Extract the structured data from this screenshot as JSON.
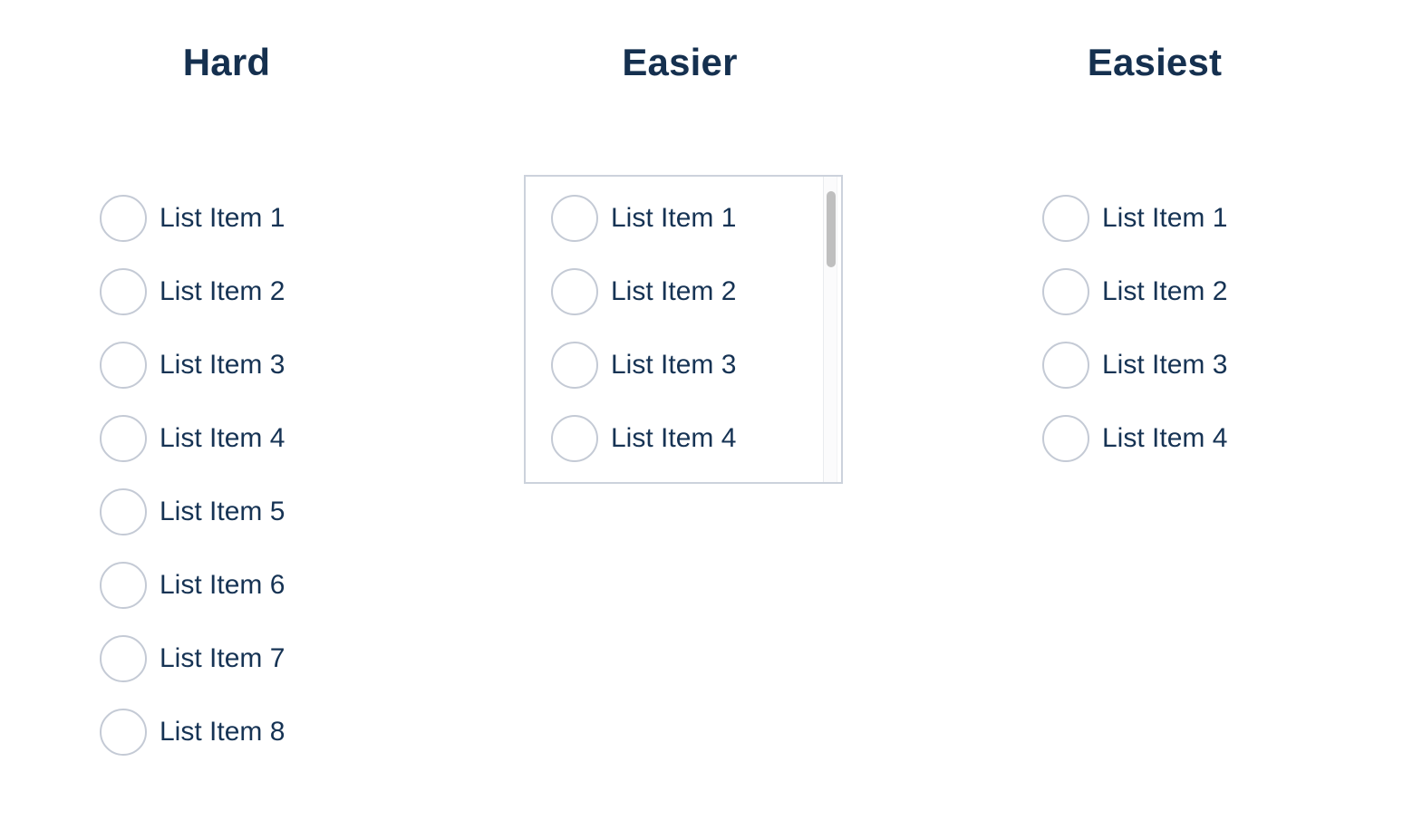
{
  "page": {
    "background_color": "#ffffff",
    "text_color": "#163354",
    "heading_color": "#15304f",
    "radio_border_color": "#c4cad5",
    "box_border_color": "#ccd2dc",
    "scrollbar_thumb_color": "#bfbfbf"
  },
  "columns": [
    {
      "id": "hard",
      "title": "Hard",
      "scrollable": false,
      "items": [
        {
          "label": "List Item 1"
        },
        {
          "label": "List Item 2"
        },
        {
          "label": "List Item 3"
        },
        {
          "label": "List Item 4"
        },
        {
          "label": "List Item 5"
        },
        {
          "label": "List Item 6"
        },
        {
          "label": "List Item 7"
        },
        {
          "label": "List Item 8"
        }
      ]
    },
    {
      "id": "easier",
      "title": "Easier",
      "scrollable": true,
      "items": [
        {
          "label": "List Item 1"
        },
        {
          "label": "List Item 2"
        },
        {
          "label": "List Item 3"
        },
        {
          "label": "List Item 4"
        }
      ]
    },
    {
      "id": "easiest",
      "title": "Easiest",
      "scrollable": false,
      "items": [
        {
          "label": "List Item 1"
        },
        {
          "label": "List Item 2"
        },
        {
          "label": "List Item 3"
        },
        {
          "label": "List Item 4"
        }
      ]
    }
  ]
}
